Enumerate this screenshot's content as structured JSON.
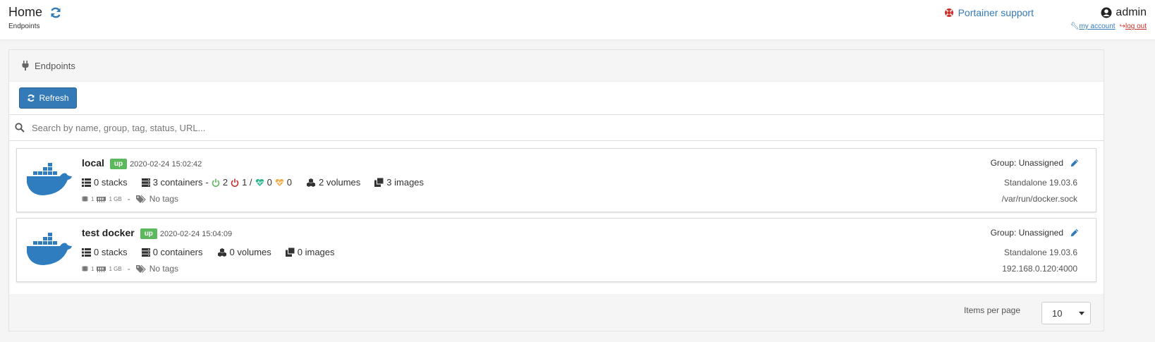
{
  "header": {
    "title": "Home",
    "breadcrumb": "Endpoints",
    "support_label": "Portainer support",
    "username": "admin",
    "my_account_label": "my account",
    "logout_label": "log out"
  },
  "panel": {
    "title": "Endpoints",
    "refresh_label": "Refresh",
    "search_placeholder": "Search by name, group, tag, status, URL..."
  },
  "endpoints": [
    {
      "name": "local",
      "status": "up",
      "timestamp": "2020-02-24 15:02:42",
      "stacks": "0 stacks",
      "containers": "3 containers",
      "containers_separator": "-",
      "running": "2",
      "stopped": "1 /",
      "healthy": "0",
      "unhealthy": "0",
      "volumes": "2 volumes",
      "images": "3 images",
      "cpu": "1",
      "memory": "1 GB",
      "meta_separator": "-",
      "tags": "No tags",
      "group": "Group: Unassigned",
      "docker": "Standalone 19.03.6",
      "url": "/var/run/docker.sock"
    },
    {
      "name": "test docker",
      "status": "up",
      "timestamp": "2020-02-24 15:04:09",
      "stacks": "0 stacks",
      "containers": "0 containers",
      "volumes": "0 volumes",
      "images": "0 images",
      "cpu": "1",
      "memory": "1 GB",
      "meta_separator": "-",
      "tags": "No tags",
      "group": "Group: Unassigned",
      "docker": "Standalone 19.03.6",
      "url": "192.168.0.120:4000"
    }
  ],
  "pagination": {
    "items_per_page_label": "Items per page",
    "items_per_page_value": "10"
  },
  "colors": {
    "primary": "#337ab7",
    "status_up": "#5cb85c",
    "danger": "#c9302c",
    "healthy": "#2fb58f",
    "unhealthy": "#f0ad4e"
  }
}
